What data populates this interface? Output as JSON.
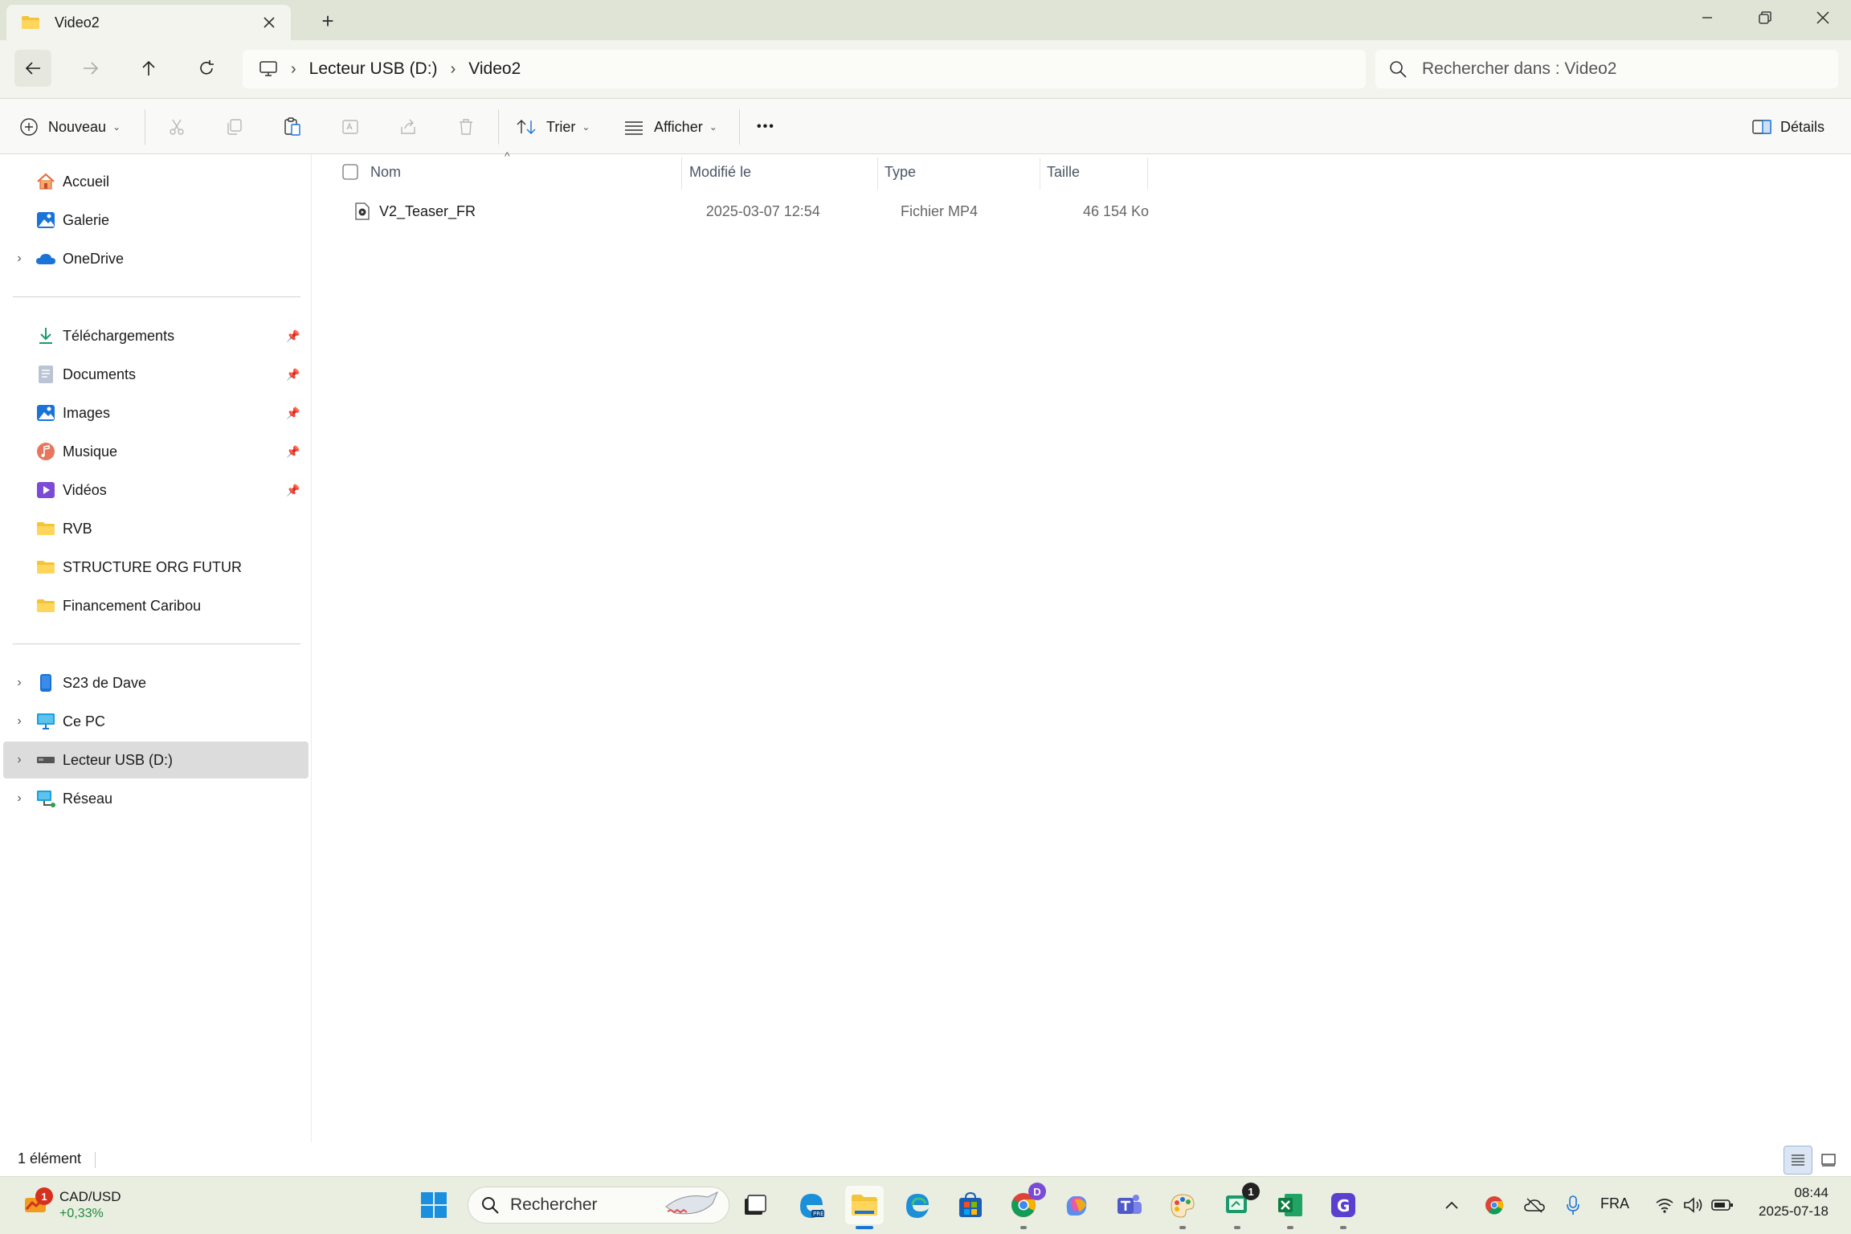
{
  "window": {
    "tab_title": "Video2",
    "tab_close_icon": "close-icon",
    "new_tab_glyph": "+"
  },
  "address": {
    "root_icon": "computer-icon",
    "crumbs": [
      "Lecteur USB (D:)",
      "Video2"
    ],
    "search_placeholder": "Rechercher dans : Video2"
  },
  "toolbar": {
    "new_label": "Nouveau",
    "sort_label": "Trier",
    "view_label": "Afficher",
    "more_label": "•••",
    "details_label": "Détails"
  },
  "sidebar": {
    "top": [
      {
        "label": "Accueil",
        "icon": "home-icon"
      },
      {
        "label": "Galerie",
        "icon": "gallery-icon"
      },
      {
        "label": "OneDrive",
        "icon": "cloud-icon",
        "expandable": true
      }
    ],
    "quick": [
      {
        "label": "Téléchargements",
        "icon": "download-icon",
        "pinned": true
      },
      {
        "label": "Documents",
        "icon": "documents-icon",
        "pinned": true
      },
      {
        "label": "Images",
        "icon": "images-icon",
        "pinned": true
      },
      {
        "label": "Musique",
        "icon": "music-icon",
        "pinned": true
      },
      {
        "label": "Vidéos",
        "icon": "videos-icon",
        "pinned": true
      },
      {
        "label": "RVB",
        "icon": "folder-icon",
        "pinned": false
      },
      {
        "label": "STRUCTURE ORG FUTUR",
        "icon": "folder-icon",
        "pinned": false
      },
      {
        "label": "Financement Caribou",
        "icon": "folder-icon",
        "pinned": false
      }
    ],
    "devices": [
      {
        "label": "S23 de Dave",
        "icon": "phone-icon",
        "expandable": true
      },
      {
        "label": "Ce PC",
        "icon": "pc-icon",
        "expandable": true
      },
      {
        "label": "Lecteur USB (D:)",
        "icon": "usb-drive-icon",
        "expandable": true,
        "selected": true
      },
      {
        "label": "Réseau",
        "icon": "network-icon",
        "expandable": true
      }
    ]
  },
  "columns": {
    "name": "Nom",
    "modified": "Modifié le",
    "type": "Type",
    "size": "Taille"
  },
  "files": [
    {
      "name": "V2_Teaser_FR",
      "modified": "2025-03-07 12:54",
      "type": "Fichier MP4",
      "size": "46 154 Ko",
      "icon": "video-file-icon"
    }
  ],
  "status": {
    "count": "1 élément"
  },
  "taskbar": {
    "widget_title": "CAD/USD",
    "widget_value": "+0,33%",
    "widget_badge": "1",
    "search_label": "Rechercher",
    "chrome_badge": "D",
    "notes_badge": "1",
    "language": "FRA",
    "time": "08:44",
    "date": "2025-07-18"
  },
  "colors": {
    "accent": "#1a73d9",
    "titlebar": "#dfe4d6",
    "taskbar": "#e9eee0",
    "selected": "#dcdcdc"
  }
}
